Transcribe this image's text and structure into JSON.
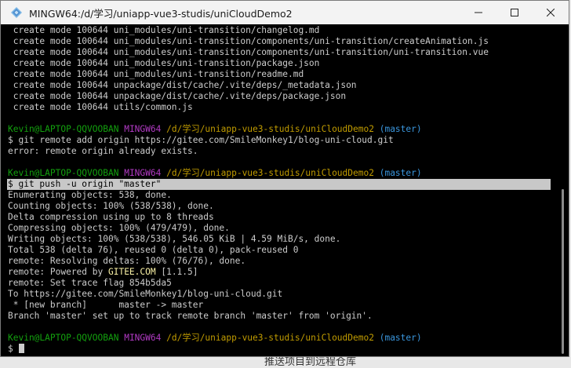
{
  "window": {
    "title": "MINGW64:/d/学习/uniapp-vue3-studis/uniCloudDemo2",
    "icons": {
      "app": "mingw-terminal-icon",
      "minimize": "minimize-icon",
      "maximize": "maximize-icon",
      "close": "close-icon"
    }
  },
  "colors": {
    "user": "#13a10e",
    "system": "#b23ac4",
    "path": "#c19c00",
    "branch": "#3a96dd",
    "text": "#cccccc",
    "highlight": "#c8c8c8",
    "gitee": "#f9f1a5"
  },
  "terminal": {
    "create_lines": [
      " create mode 100644 uni_modules/uni-transition/changelog.md",
      " create mode 100644 uni_modules/uni-transition/components/uni-transition/createAnimation.js",
      " create mode 100644 uni_modules/uni-transition/components/uni-transition/uni-transition.vue",
      " create mode 100644 uni_modules/uni-transition/package.json",
      " create mode 100644 uni_modules/uni-transition/readme.md",
      " create mode 100644 unpackage/dist/cache/.vite/deps/_metadata.json",
      " create mode 100644 unpackage/dist/cache/.vite/deps/package.json",
      " create mode 100644 utils/common.js"
    ],
    "prompt": {
      "user": "Kevin@LAPTOP-QQVOOBAN",
      "system": "MINGW64",
      "path": "/d/学习/uniapp-vue3-studis/uniCloudDemo2",
      "branch": "(master)"
    },
    "command1": "$ git remote add origin https://gitee.com/SmileMonkey1/blog-uni-cloud.git",
    "error1": "error: remote origin already exists.",
    "command2": "$ git push -u origin \"master\"",
    "push_output_a": [
      "Enumerating objects: 538, done.",
      "Counting objects: 100% (538/538), done.",
      "Delta compression using up to 8 threads",
      "Compressing objects: 100% (479/479), done.",
      "Writing objects: 100% (538/538), 546.05 KiB | 4.59 MiB/s, done.",
      "Total 538 (delta 76), reused 0 (delta 0), pack-reused 0",
      "remote: Resolving deltas: 100% (76/76), done."
    ],
    "powered_prefix": "remote: Powered by ",
    "powered_brand": "GITEE.COM",
    "powered_suffix": " [1.1.5]",
    "push_output_b": [
      "remote: Set trace flag 854b5da5",
      "To https://gitee.com/SmileMonkey1/blog-uni-cloud.git",
      " * [new branch]      master -> master",
      "Branch 'master' set up to track remote branch 'master' from 'origin'."
    ],
    "final_prompt": "$"
  },
  "background_window_text": "推送项目到远程仓库"
}
